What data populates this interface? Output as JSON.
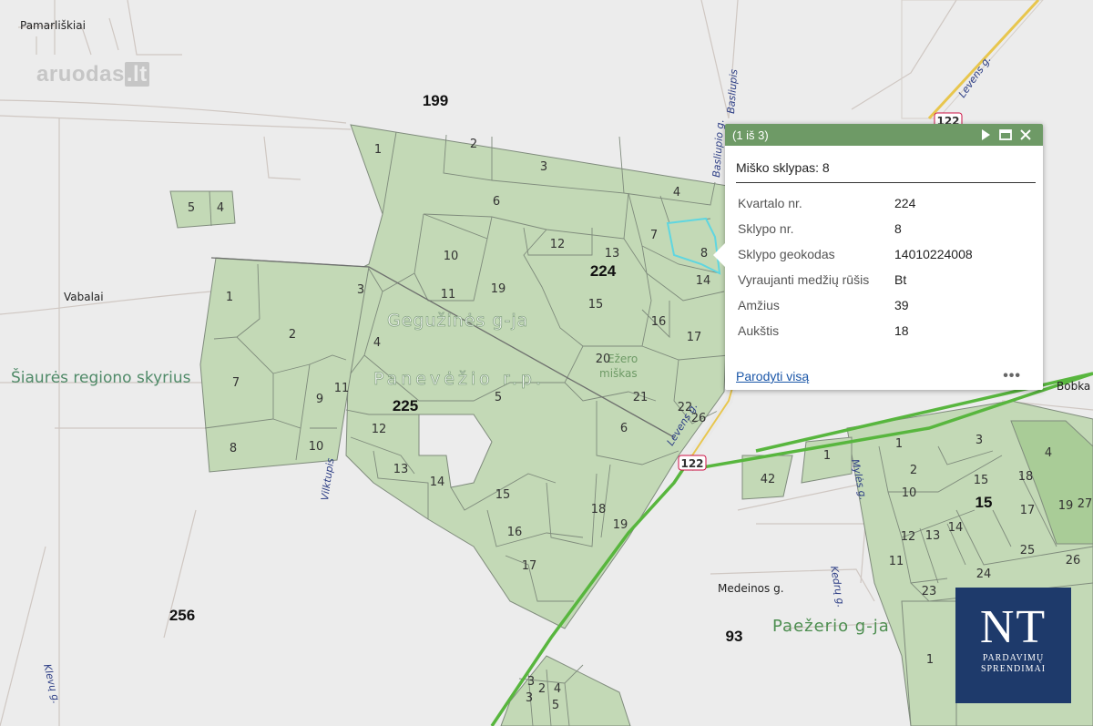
{
  "map": {
    "quarters": [
      "199",
      "224",
      "225",
      "256",
      "93",
      "15"
    ],
    "places": [
      "Pamarliškiai",
      "Vabalai",
      "Medeinos g.",
      "Bobka"
    ],
    "streets": [
      "Basliupis",
      "Basliupio g.",
      "Levens g.",
      "Vilktupis",
      "Mylės g.",
      "Kedrų g.",
      "Klevų g.",
      "Levens g."
    ],
    "road_numbers": [
      "122",
      "122"
    ],
    "area_labels": {
      "geguzines": "Gegužinės g-ja",
      "panevezio": "Panevėžio r.p.",
      "siaures": "Šiaurės regiono skyrius",
      "paezerio": "Paežerio g-ja",
      "ezero_1": "Ežero",
      "ezero_2": "miškas"
    },
    "watermark": {
      "brand": "aruodas",
      "suffix": ".lt"
    },
    "parcels": [
      "1",
      "2",
      "3",
      "4",
      "5",
      "6",
      "7",
      "8",
      "10",
      "11",
      "12",
      "13",
      "14",
      "15",
      "16",
      "17",
      "18",
      "19",
      "20",
      "21",
      "22",
      "23",
      "24",
      "25",
      "26",
      "27",
      "42"
    ]
  },
  "popup": {
    "counter": "(1 iš 3)",
    "title": "Miško sklypas: 8",
    "attributes": [
      {
        "key": "Kvartalo nr.",
        "value": "224"
      },
      {
        "key": "Sklypo nr.",
        "value": "8"
      },
      {
        "key": "Sklypo geokodas",
        "value": "14010224008"
      },
      {
        "key": "Vyraujanti medžių rūšis",
        "value": "Bt"
      },
      {
        "key": "Amžius",
        "value": "39"
      },
      {
        "key": "Aukštis",
        "value": "18"
      }
    ],
    "show_all": "Parodyti visą",
    "more": "•••"
  },
  "logo": {
    "initials": "NT",
    "line1": "PARDAVIMŲ",
    "line2": "SPRENDIMAI"
  },
  "colors": {
    "forest": "#c3d9b6",
    "popup_header": "#6e9a66",
    "road": "#58b63e",
    "logo_bg": "#1e3a6b",
    "highlight": "#5fd6e0"
  }
}
